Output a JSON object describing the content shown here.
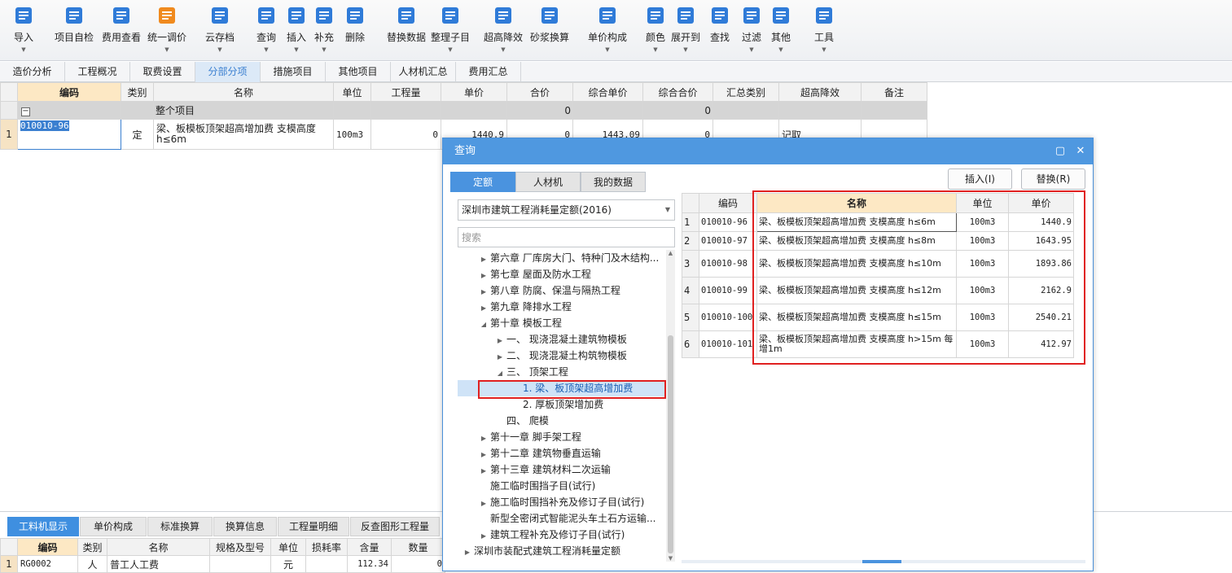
{
  "toolbar": {
    "buttons": [
      {
        "label": "导入",
        "icon": "import-icon",
        "dd": true
      },
      {
        "label": "项目自检",
        "icon": "check-icon",
        "dd": false
      },
      {
        "label": "费用查看",
        "icon": "fee-view-icon",
        "dd": false
      },
      {
        "label": "统一调价",
        "icon": "price-adjust-icon",
        "dd": true
      },
      {
        "label": "云存档",
        "icon": "cloud-upload-icon",
        "dd": true
      },
      {
        "label": "查询",
        "icon": "query-icon",
        "dd": true
      },
      {
        "label": "插入",
        "icon": "insert-icon",
        "dd": true
      },
      {
        "label": "补充",
        "icon": "supplement-icon",
        "dd": true
      },
      {
        "label": "删除",
        "icon": "delete-icon",
        "dd": false
      },
      {
        "label": "替换数据",
        "icon": "replace-data-icon",
        "dd": false
      },
      {
        "label": "整理子目",
        "icon": "organize-icon",
        "dd": true
      },
      {
        "label": "超高降效",
        "icon": "height-reduce-icon",
        "dd": true
      },
      {
        "label": "砂浆换算",
        "icon": "mortar-icon",
        "dd": false
      },
      {
        "label": "单价构成",
        "icon": "unit-price-icon",
        "dd": true
      },
      {
        "label": "颜色",
        "icon": "color-icon",
        "dd": true
      },
      {
        "label": "展开到",
        "icon": "expand-icon",
        "dd": true
      },
      {
        "label": "查找",
        "icon": "binoculars-icon",
        "dd": false
      },
      {
        "label": "过滤",
        "icon": "filter-icon",
        "dd": true
      },
      {
        "label": "其他",
        "icon": "other-icon",
        "dd": true
      },
      {
        "label": "工具",
        "icon": "tools-icon",
        "dd": true
      }
    ]
  },
  "tabs": [
    "造价分析",
    "工程概况",
    "取费设置",
    "分部分项",
    "措施项目",
    "其他项目",
    "人材机汇总",
    "费用汇总"
  ],
  "main_grid": {
    "headers": [
      "编码",
      "类别",
      "名称",
      "单位",
      "工程量",
      "单价",
      "合价",
      "综合单价",
      "综合合价",
      "汇总类别",
      "超高降效",
      "备注"
    ],
    "group_row": {
      "name": "整个项目",
      "total": "0",
      "total2": "0"
    },
    "rows": [
      {
        "num": "1",
        "code": "010010-96",
        "type": "定",
        "name": "梁、板模板顶架超高增加费 支模高度h≤6m",
        "unit": "100m3",
        "qty": "0",
        "price": "1440.9",
        "total": "0",
        "comp_price": "1443.09",
        "comp_total": "0",
        "cat": "",
        "height": "记取",
        "note": ""
      }
    ]
  },
  "bottom": {
    "tabs": [
      "工料机显示",
      "单价构成",
      "标准换算",
      "换算信息",
      "工程量明细",
      "反查图形工程量"
    ],
    "headers": [
      "编码",
      "类别",
      "名称",
      "规格及型号",
      "单位",
      "损耗率",
      "含量",
      "数量"
    ],
    "rows": [
      {
        "num": "1",
        "code": "RG0002",
        "type": "人",
        "name": "普工人工费",
        "spec": "",
        "unit": "元",
        "loss": "",
        "content": "112.34",
        "qty": "0"
      }
    ]
  },
  "dialog": {
    "title": "查询",
    "tabs": [
      "定额",
      "人材机",
      "我的数据"
    ],
    "insert_label": "插入(I)",
    "replace_label": "替换(R)",
    "library": "深圳市建筑工程消耗量定额(2016)",
    "search_placeholder": "搜索",
    "tree": [
      {
        "label": "第六章 厂库房大门、特种门及木结构...",
        "level": 1,
        "arrow": "right"
      },
      {
        "label": "第七章 屋面及防水工程",
        "level": 1,
        "arrow": "right"
      },
      {
        "label": "第八章 防腐、保温与隔热工程",
        "level": 1,
        "arrow": "right"
      },
      {
        "label": "第九章 降排水工程",
        "level": 1,
        "arrow": "right"
      },
      {
        "label": "第十章 模板工程",
        "level": 1,
        "arrow": "down"
      },
      {
        "label": "一、 现浇混凝土建筑物模板",
        "level": 2,
        "arrow": "right"
      },
      {
        "label": "二、 现浇混凝土构筑物模板",
        "level": 2,
        "arrow": "right"
      },
      {
        "label": "三、 顶架工程",
        "level": 2,
        "arrow": "down"
      },
      {
        "label": "1. 梁、板顶架超高增加费",
        "level": 3,
        "arrow": "",
        "selected": true
      },
      {
        "label": "2. 厚板顶架增加费",
        "level": 3,
        "arrow": ""
      },
      {
        "label": "四、 爬模",
        "level": 2,
        "arrow": ""
      },
      {
        "label": "第十一章 脚手架工程",
        "level": 1,
        "arrow": "right"
      },
      {
        "label": "第十二章 建筑物垂直运输",
        "level": 1,
        "arrow": "right"
      },
      {
        "label": "第十三章 建筑材料二次运输",
        "level": 1,
        "arrow": "right"
      },
      {
        "label": "施工临时围挡子目(试行)",
        "level": 1,
        "arrow": ""
      },
      {
        "label": "施工临时围挡补充及修订子目(试行)",
        "level": 1,
        "arrow": "right"
      },
      {
        "label": "新型全密闭式智能泥头车土石方运输...",
        "level": 1,
        "arrow": ""
      },
      {
        "label": "建筑工程补充及修订子目(试行)",
        "level": 1,
        "arrow": "right"
      },
      {
        "label": "深圳市装配式建筑工程消耗量定额",
        "level": 0,
        "arrow": "right"
      }
    ],
    "grid_headers": [
      "编码",
      "名称",
      "单位",
      "单价"
    ],
    "grid_rows": [
      {
        "num": "1",
        "code": "010010-96",
        "name": "梁、板模板顶架超高增加费 支模高度 h≤6m",
        "unit": "100m3",
        "price": "1440.9"
      },
      {
        "num": "2",
        "code": "010010-97",
        "name": "梁、板模板顶架超高增加费 支模高度 h≤8m",
        "unit": "100m3",
        "price": "1643.95"
      },
      {
        "num": "3",
        "code": "010010-98",
        "name": "梁、板模板顶架超高增加费 支模高度 h≤10m",
        "unit": "100m3",
        "price": "1893.86"
      },
      {
        "num": "4",
        "code": "010010-99",
        "name": "梁、板模板顶架超高增加费 支模高度 h≤12m",
        "unit": "100m3",
        "price": "2162.9"
      },
      {
        "num": "5",
        "code": "010010-100",
        "name": "梁、板模板顶架超高增加费 支模高度 h≤15m",
        "unit": "100m3",
        "price": "2540.21"
      },
      {
        "num": "6",
        "code": "010010-101",
        "name": "梁、板模板顶架超高增加费 支模高度 h>15m 每增1m",
        "unit": "100m3",
        "price": "412.97"
      }
    ]
  },
  "colors": {
    "accent": "#4a93df",
    "highlight": "#e02020",
    "header_code": "#fde8c4",
    "rownum": "#f6e3c4"
  }
}
